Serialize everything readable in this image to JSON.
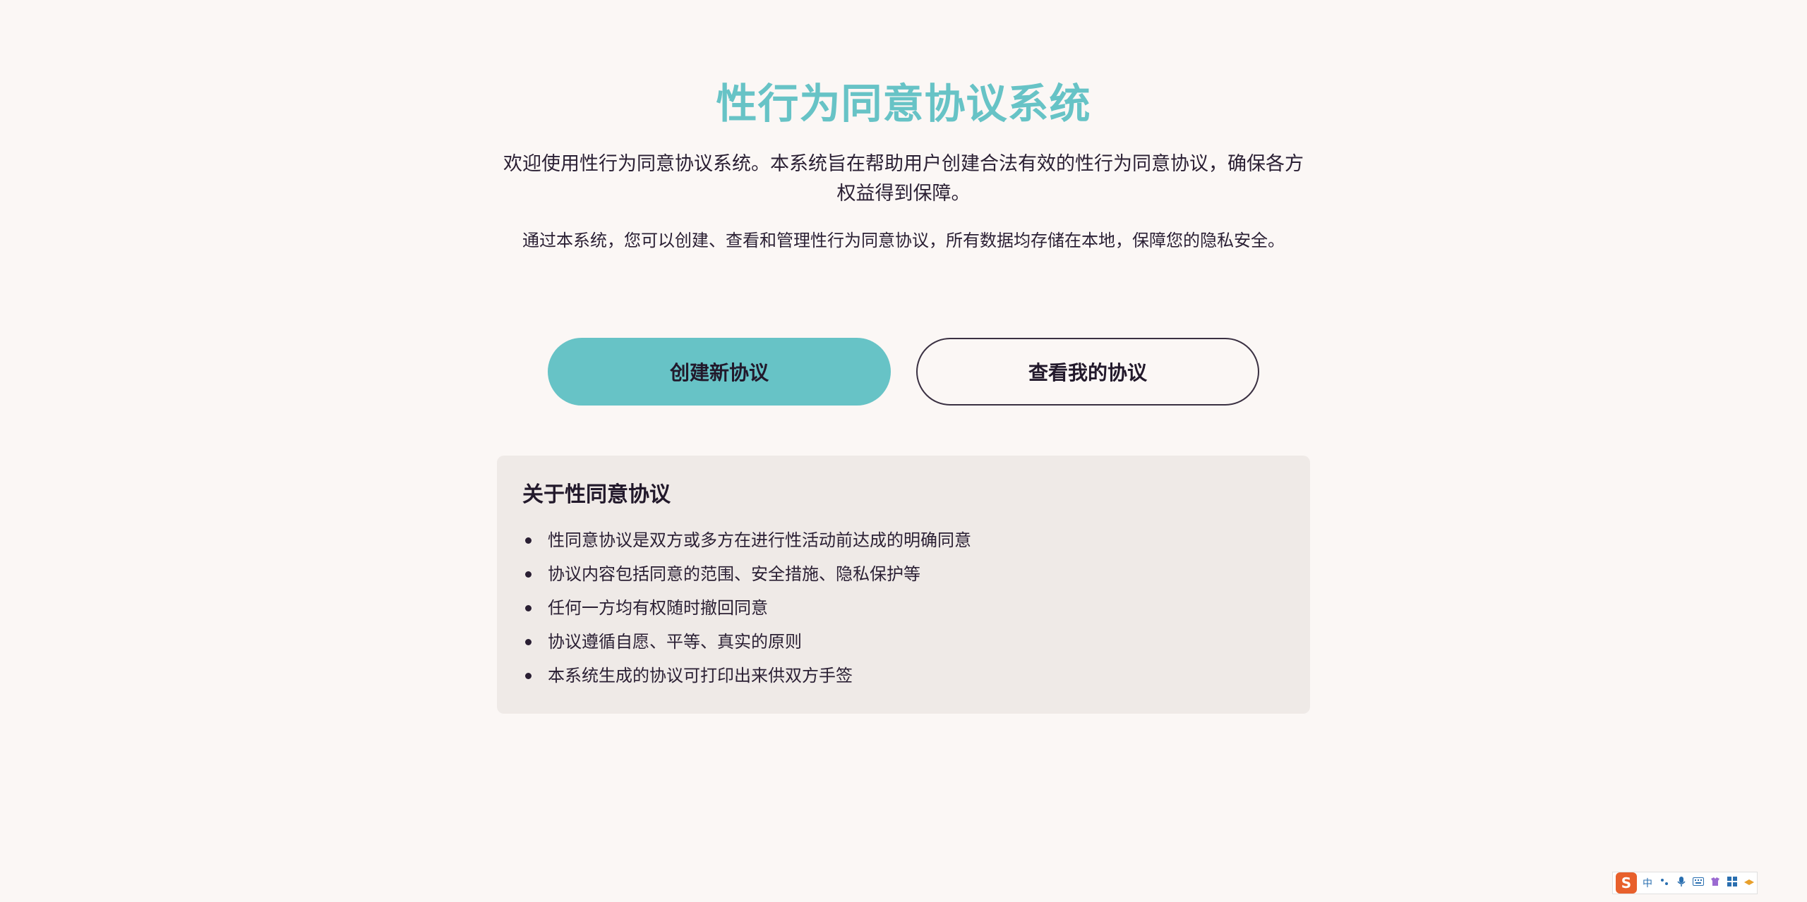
{
  "header": {
    "title": "性行为同意协议系统",
    "intro": "欢迎使用性行为同意协议系统。本系统旨在帮助用户创建合法有效的性行为同意协议，确保各方权益得到保障。",
    "intro_secondary": "通过本系统，您可以创建、查看和管理性行为同意协议，所有数据均存储在本地，保障您的隐私安全。"
  },
  "actions": {
    "create_label": "创建新协议",
    "view_label": "查看我的协议"
  },
  "about": {
    "heading": "关于性同意协议",
    "items": [
      "性同意协议是双方或多方在进行性活动前达成的明确同意",
      "协议内容包括同意的范围、安全措施、隐私保护等",
      "任何一方均有权随时撤回同意",
      "协议遵循自愿、平等、真实的原则",
      "本系统生成的协议可打印出来供双方手签"
    ]
  },
  "ime_toolbar": {
    "logo": "S",
    "lang": "中",
    "icons": [
      "punctuation-icon",
      "microphone-icon",
      "keyboard-icon",
      "skin-icon",
      "grid-icon",
      "more-icon"
    ]
  },
  "colors": {
    "accent": "#67c3c6",
    "background": "#fbf7f5",
    "panel": "#efeae7",
    "text": "#2a1f33"
  }
}
